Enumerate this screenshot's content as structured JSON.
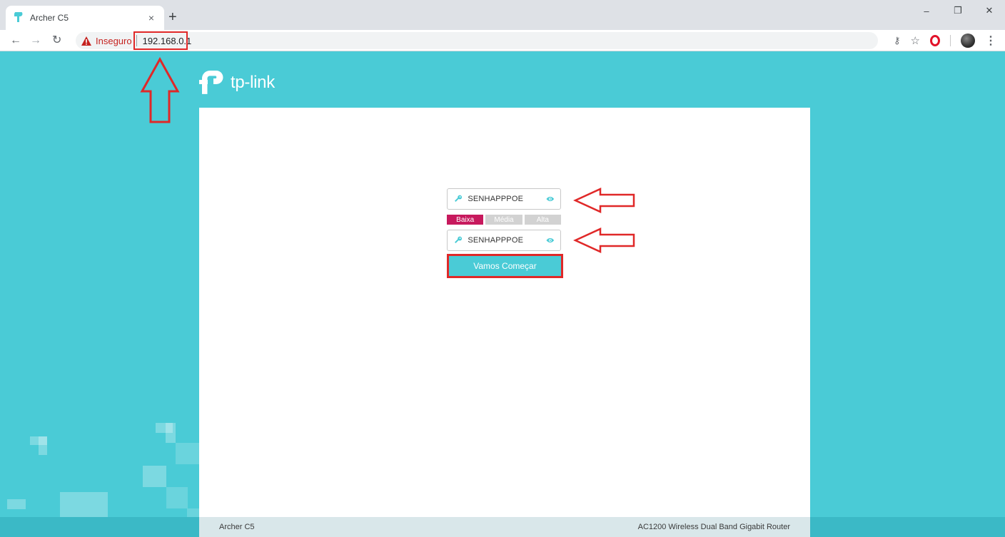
{
  "browser": {
    "tab_title": "Archer C5",
    "tab_close": "×",
    "new_tab": "+",
    "security_label": "Inseguro",
    "url": "192.168.0.1",
    "window_controls": {
      "minimize": "–",
      "restore": "❐",
      "close": "✕"
    },
    "toolbar_icons": [
      "key-icon",
      "star-icon",
      "opera-icon",
      "avatar",
      "kebab-menu-icon"
    ]
  },
  "page": {
    "logo_text": "tp-link",
    "password_value": "SENHAPPPOE",
    "confirm_value": "SENHAPPPOE",
    "strength": {
      "low": "Baixa",
      "medium": "Média",
      "high": "Alta",
      "level": "low"
    },
    "start_button": "Vamos Começar",
    "footer_left": "Archer C5",
    "footer_right": "AC1200 Wireless Dual Band Gigabit Router"
  },
  "colors": {
    "brand_teal": "#4acbd6",
    "strength_low": "#c7195d",
    "annotation_red": "#e02828",
    "insecure_red": "#c5221f"
  }
}
